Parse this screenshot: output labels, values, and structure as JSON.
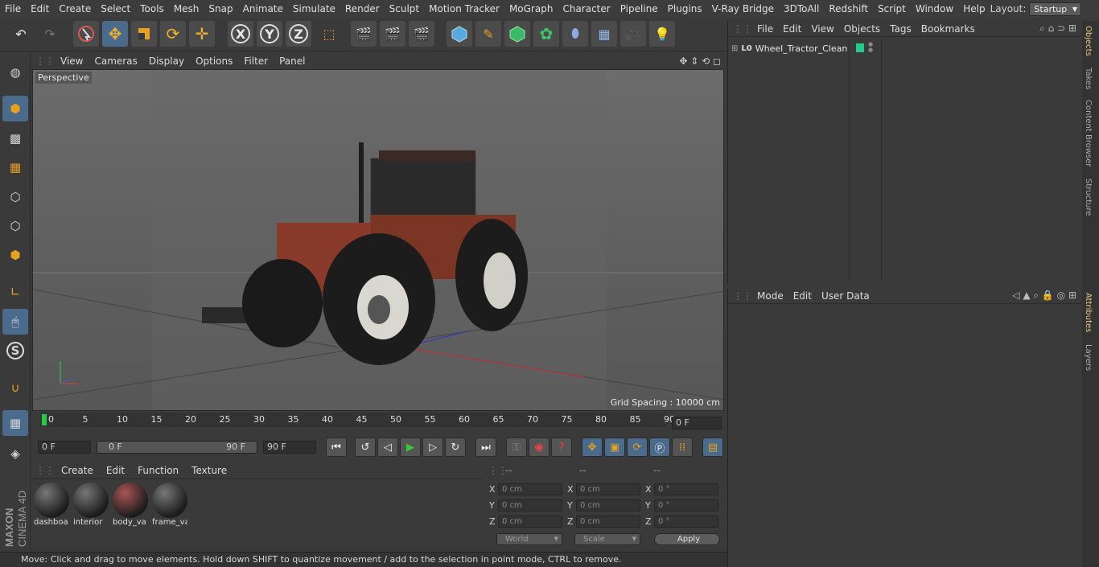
{
  "menu": [
    "File",
    "Edit",
    "Create",
    "Select",
    "Tools",
    "Mesh",
    "Snap",
    "Animate",
    "Simulate",
    "Render",
    "Sculpt",
    "Motion Tracker",
    "MoGraph",
    "Character",
    "Pipeline",
    "Plugins",
    "V-Ray Bridge",
    "3DToAll",
    "Redshift",
    "Script",
    "Window",
    "Help"
  ],
  "layout": {
    "label": "Layout:",
    "value": "Startup"
  },
  "toolbar": {
    "x": "X",
    "y": "Y",
    "z": "Z"
  },
  "viewport": {
    "menu": [
      "View",
      "Cameras",
      "Display",
      "Options",
      "Filter",
      "Panel"
    ],
    "label": "Perspective",
    "grid_spacing": "Grid Spacing : 10000 cm"
  },
  "timeline": {
    "ticks": [
      "0",
      "5",
      "10",
      "15",
      "20",
      "25",
      "30",
      "35",
      "40",
      "45",
      "50",
      "55",
      "60",
      "65",
      "70",
      "75",
      "80",
      "85",
      "90"
    ],
    "current": "0 F"
  },
  "transport": {
    "start": "0 F",
    "range_start": "0 F",
    "range_end": "90 F",
    "end": "90 F"
  },
  "materials": {
    "menu": [
      "Create",
      "Edit",
      "Function",
      "Texture"
    ],
    "items": [
      "dashboa",
      "interior",
      "body_va",
      "frame_va"
    ]
  },
  "coords": {
    "headers": [
      "--",
      "--",
      "--"
    ],
    "rows": [
      {
        "axis": "X",
        "pos": "0 cm",
        "size": "0 cm",
        "rot_axis": "X",
        "rot": "0 °"
      },
      {
        "axis": "Y",
        "pos": "0 cm",
        "size": "0 cm",
        "rot_axis": "Y",
        "rot": "0 °"
      },
      {
        "axis": "Z",
        "pos": "0 cm",
        "size": "0 cm",
        "rot_axis": "Z",
        "rot": "0 °"
      }
    ],
    "world": "World",
    "scale": "Scale",
    "apply": "Apply"
  },
  "status": "Move: Click and drag to move elements. Hold down SHIFT to quantize movement / add to the selection in point mode, CTRL to remove.",
  "objects": {
    "menu": [
      "File",
      "Edit",
      "View",
      "Objects",
      "Tags",
      "Bookmarks"
    ],
    "tree": [
      {
        "name": "Wheel_Tractor_Clean",
        "color": "#22cc88"
      }
    ]
  },
  "attributes": {
    "menu": [
      "Mode",
      "Edit",
      "User Data"
    ]
  },
  "sidetabs": [
    "Objects",
    "Takes",
    "Content Browser",
    "Structure",
    "Attributes",
    "Layers"
  ],
  "brand": {
    "line1": "MAXON",
    "line2": "CINEMA 4D"
  }
}
